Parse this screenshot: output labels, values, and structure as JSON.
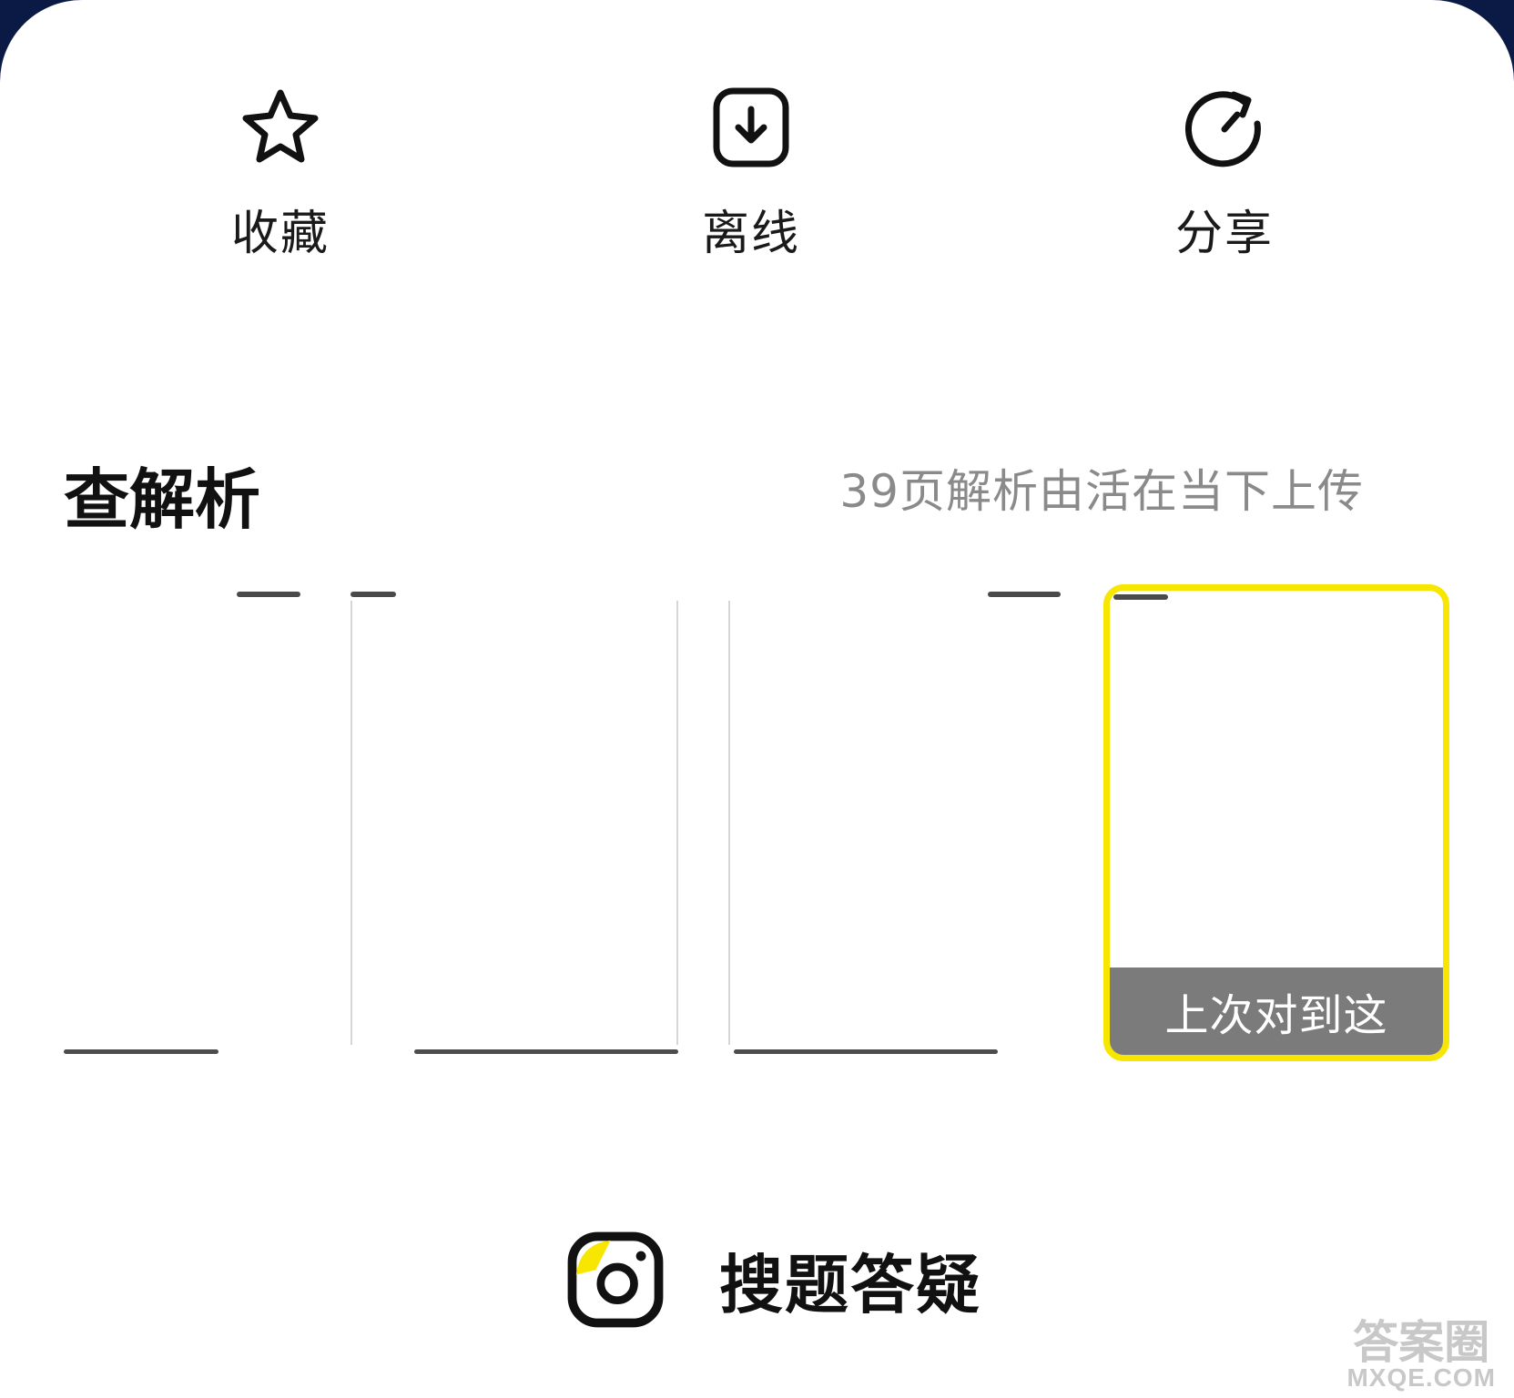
{
  "actions": {
    "favorite": {
      "label": "收藏",
      "icon": "star-icon"
    },
    "offline": {
      "label": "离线",
      "icon": "download-box-icon"
    },
    "share": {
      "label": "分享",
      "icon": "share-icon"
    }
  },
  "section": {
    "title": "查解析",
    "meta": "39页解析由活在当下上传"
  },
  "pages": {
    "last_position_label": "上次对到这",
    "highlight_color": "#f6e600"
  },
  "search": {
    "label": "搜题答疑",
    "icon": "camera-icon",
    "accent_color": "#f6e600"
  },
  "watermark": {
    "top": "答案圈",
    "bottom": "MXQE.COM"
  }
}
